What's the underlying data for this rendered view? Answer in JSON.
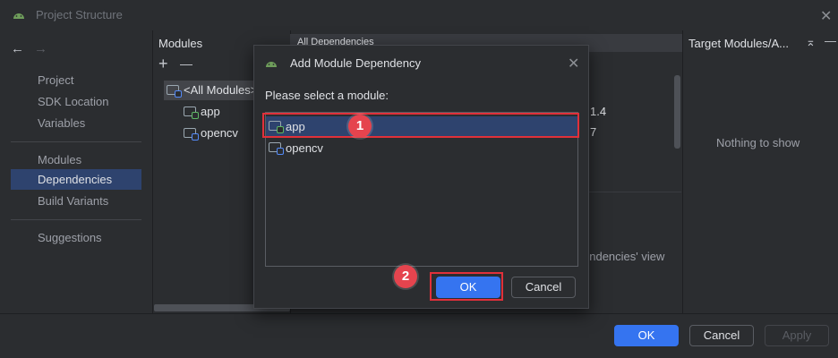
{
  "window": {
    "title": "Project Structure"
  },
  "nav": {
    "items": [
      {
        "label": "Project"
      },
      {
        "label": "SDK Location"
      },
      {
        "label": "Variables"
      },
      {
        "label": "Modules"
      },
      {
        "label": "Dependencies",
        "selected": true
      },
      {
        "label": "Build Variants"
      },
      {
        "label": "Suggestions"
      }
    ]
  },
  "modules_panel": {
    "title": "Modules",
    "add": "+",
    "remove": "—",
    "items": [
      {
        "label": "<All Modules>",
        "selected": true
      },
      {
        "label": "app"
      },
      {
        "label": "opencv"
      }
    ]
  },
  "deps_panel": {
    "header": "All Dependencies",
    "fragment_a": "1.4",
    "fragment_b": "7",
    "fragment_c": "endencies' view"
  },
  "target_panel": {
    "title": "Target Modules/A...",
    "empty": "Nothing to show"
  },
  "dialog": {
    "title": "Add Module Dependency",
    "prompt": "Please select a module:",
    "modules": [
      {
        "label": "app",
        "selected": true
      },
      {
        "label": "opencv"
      }
    ],
    "ok": "OK",
    "cancel": "Cancel"
  },
  "footer": {
    "ok": "OK",
    "cancel": "Cancel",
    "apply": "Apply"
  },
  "annotations": {
    "step1": "1",
    "step2": "2",
    "color": "#e0303a"
  }
}
